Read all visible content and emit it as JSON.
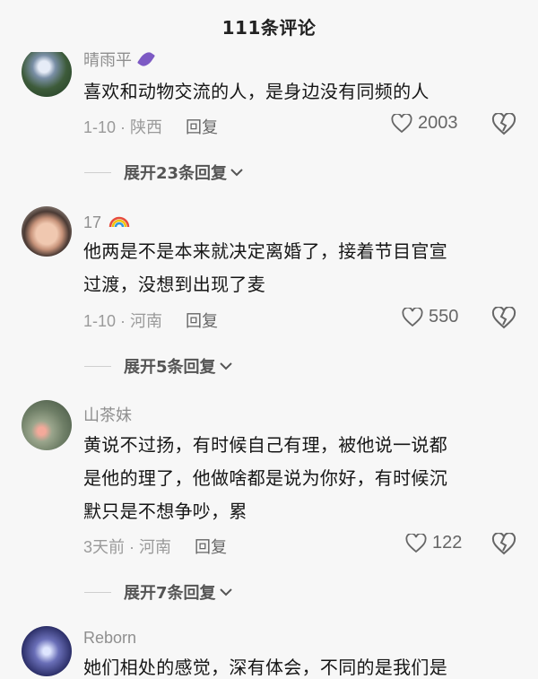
{
  "header": {
    "title": "111条评论"
  },
  "comments": [
    {
      "username": "晴雨平",
      "text_lines": [
        "喜欢和动物交流的人，是身边没有同频的人"
      ],
      "date_location": "1-10 · 陕西",
      "reply_label": "回复",
      "likes": "2003",
      "expand_label": "展开23条回复"
    },
    {
      "username": "17",
      "text_lines": [
        "他两是不是本来就决定离婚了，接着节目官宣",
        "过渡，没想到出现了麦"
      ],
      "date_location": "1-10 · 河南",
      "reply_label": "回复",
      "likes": "550",
      "expand_label": "展开5条回复"
    },
    {
      "username": "山茶妹",
      "text_lines": [
        "黄说不过扬，有时候自己有理，被他说一说都",
        "是他的理了，他做啥都是说为你好，有时候沉",
        "默只是不想争吵，累"
      ],
      "date_location": "3天前 · 河南",
      "reply_label": "回复",
      "likes": "122",
      "expand_label": "展开7条回复"
    },
    {
      "username": "Reborn",
      "text_partial": "她们相处的感觉，深有体会，不同的是我们是"
    }
  ],
  "icons": {
    "like": "heart-outline-icon",
    "dislike": "broken-heart-icon",
    "expand": "chevron-down-icon",
    "badge1": "leaf-badge-icon",
    "badge2": "rainbow-icon"
  }
}
